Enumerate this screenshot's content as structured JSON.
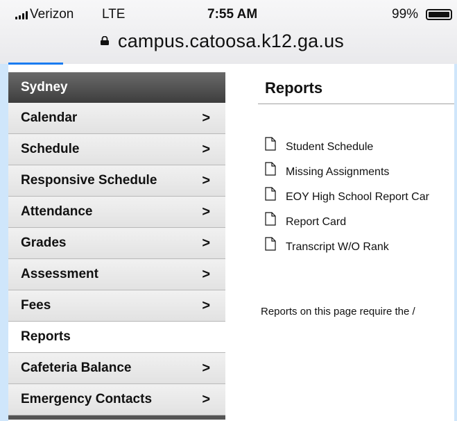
{
  "status_bar": {
    "carrier": "Verizon",
    "network": "LTE",
    "time": "7:55 AM",
    "battery_percent": "99%",
    "battery_level": 0.99,
    "signal_icon": "signal-bars-icon",
    "battery_icon": "battery-icon"
  },
  "browser": {
    "url": "campus.catoosa.k12.ga.us",
    "lock_icon": "lock-icon",
    "load_progress": 0.12,
    "accent_color": "#1a7cf0"
  },
  "sidebar": {
    "header": "Sydney",
    "items": [
      {
        "label": "Calendar",
        "chevron": ">",
        "active": false
      },
      {
        "label": "Schedule",
        "chevron": ">",
        "active": false
      },
      {
        "label": "Responsive Schedule",
        "chevron": ">",
        "active": false
      },
      {
        "label": "Attendance",
        "chevron": ">",
        "active": false
      },
      {
        "label": "Grades",
        "chevron": ">",
        "active": false
      },
      {
        "label": "Assessment",
        "chevron": ">",
        "active": false
      },
      {
        "label": "Fees",
        "chevron": ">",
        "active": false
      },
      {
        "label": "Reports",
        "chevron": "",
        "active": true
      },
      {
        "label": "Cafeteria Balance",
        "chevron": ">",
        "active": false
      },
      {
        "label": "Emergency Contacts",
        "chevron": ">",
        "active": false
      }
    ]
  },
  "main": {
    "title": "Reports",
    "reports": [
      {
        "label": "Student Schedule",
        "icon": "document-icon"
      },
      {
        "label": "Missing Assignments",
        "icon": "document-icon"
      },
      {
        "label": "EOY High School Report Car",
        "icon": "document-icon"
      },
      {
        "label": "Report Card",
        "icon": "document-icon"
      },
      {
        "label": "Transcript W/O Rank",
        "icon": "document-icon"
      }
    ],
    "note": "Reports on this page require the /"
  }
}
